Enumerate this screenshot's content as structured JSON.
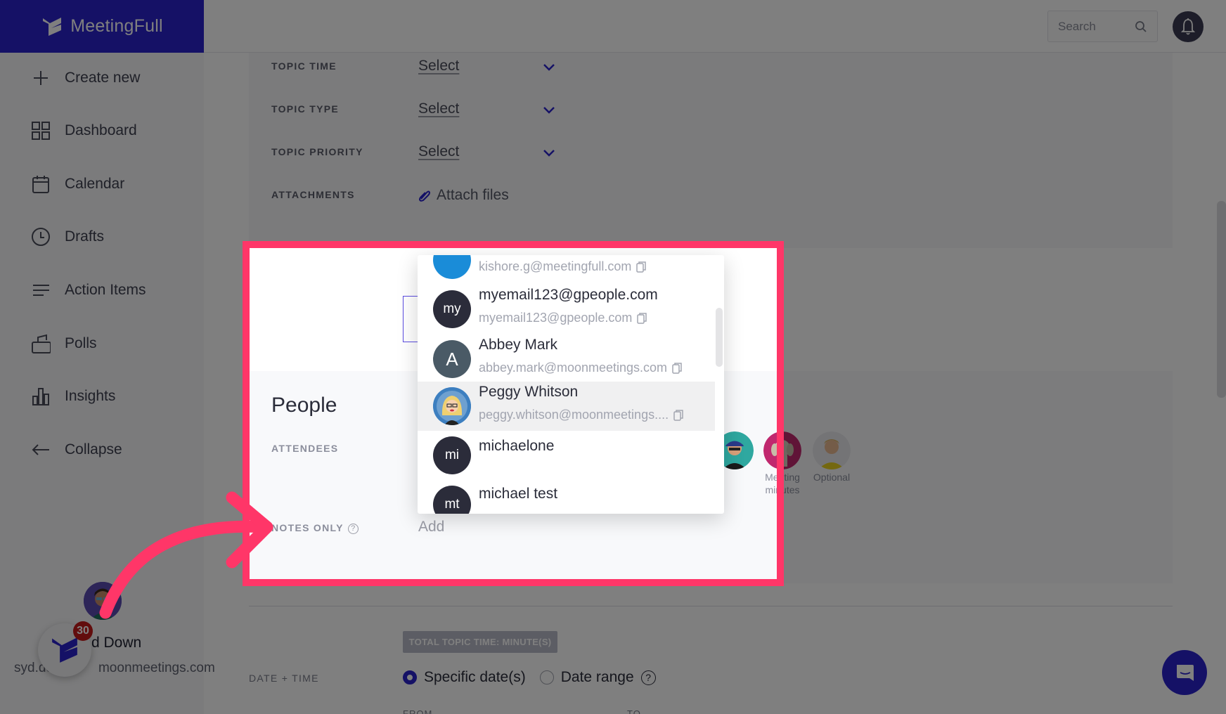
{
  "brand": {
    "name": "MeetingFull",
    "color": "#2a22cc"
  },
  "header": {
    "search_placeholder": "Search",
    "search_icon": "search-icon",
    "notification_icon": "bell-icon"
  },
  "sidebar": {
    "items": [
      {
        "label": "Create new",
        "icon": "plus-icon"
      },
      {
        "label": "Dashboard",
        "icon": "grid-icon"
      },
      {
        "label": "Calendar",
        "icon": "calendar-icon"
      },
      {
        "label": "Drafts",
        "icon": "clock-icon"
      },
      {
        "label": "Action Items",
        "icon": "list-icon"
      },
      {
        "label": "Polls",
        "icon": "ballot-box-icon"
      },
      {
        "label": "Insights",
        "icon": "bar-chart-icon"
      },
      {
        "label": "Collapse",
        "icon": "arrow-left-icon"
      }
    ],
    "user": {
      "name": "Syd Down",
      "name_visible": "d Down",
      "email": "syd.down@moonmeetings.com",
      "email_visible_left": "syd.do",
      "email_visible_right": "moonmeetings.com"
    },
    "widget_badge_count": "30"
  },
  "topic_fields": [
    {
      "label": "TOPIC TIME",
      "value": "Select"
    },
    {
      "label": "TOPIC TYPE",
      "value": "Select"
    },
    {
      "label": "TOPIC PRIORITY",
      "value": "Select"
    }
  ],
  "attachments": {
    "label": "ATTACHMENTS",
    "action": "Attach files"
  },
  "people": {
    "title": "People",
    "attendees_label": "ATTENDEES",
    "notes_only_label": "NOTES ONLY",
    "notes_only_help": "?",
    "add_label": "Add",
    "attendee_avatars": [
      {
        "label": ""
      },
      {
        "label": "Meeting minutes"
      },
      {
        "label": "Optional"
      }
    ]
  },
  "dropdown": {
    "items": [
      {
        "initials": "",
        "name": "",
        "email": "kishore.g@meetingfull.com",
        "avatar_color": "#1a8cd8",
        "partial": true
      },
      {
        "initials": "my",
        "name": "myemail123@gpeople.com",
        "email": "myemail123@gpeople.com",
        "avatar_color": "#2b2c3a"
      },
      {
        "initials": "A",
        "name": "Abbey Mark",
        "email": "abbey.mark@moonmeetings.com",
        "avatar_color": "#4a5a66"
      },
      {
        "initials": "",
        "name": "Peggy Whitson",
        "email": "peggy.whitson@moonmeetings....",
        "avatar_color": "#3d7fc0",
        "highlighted": true
      },
      {
        "initials": "mi",
        "name": "michaelone",
        "email": "",
        "avatar_color": "#2b2c3a"
      },
      {
        "initials": "mt",
        "name": "michael test",
        "email": "",
        "avatar_color": "#2b2c3a",
        "partial": true
      }
    ]
  },
  "schedule": {
    "total_topic_time": "TOTAL TOPIC TIME: MINUTE(S)",
    "date_time_label": "DATE + TIME",
    "options": [
      {
        "label": "Specific date(s)",
        "selected": true
      },
      {
        "label": "Date range",
        "selected": false
      }
    ],
    "help": "?",
    "from_label": "FROM",
    "to_label": "TO"
  },
  "overlay": {
    "highlight_color": "#ff3668"
  }
}
